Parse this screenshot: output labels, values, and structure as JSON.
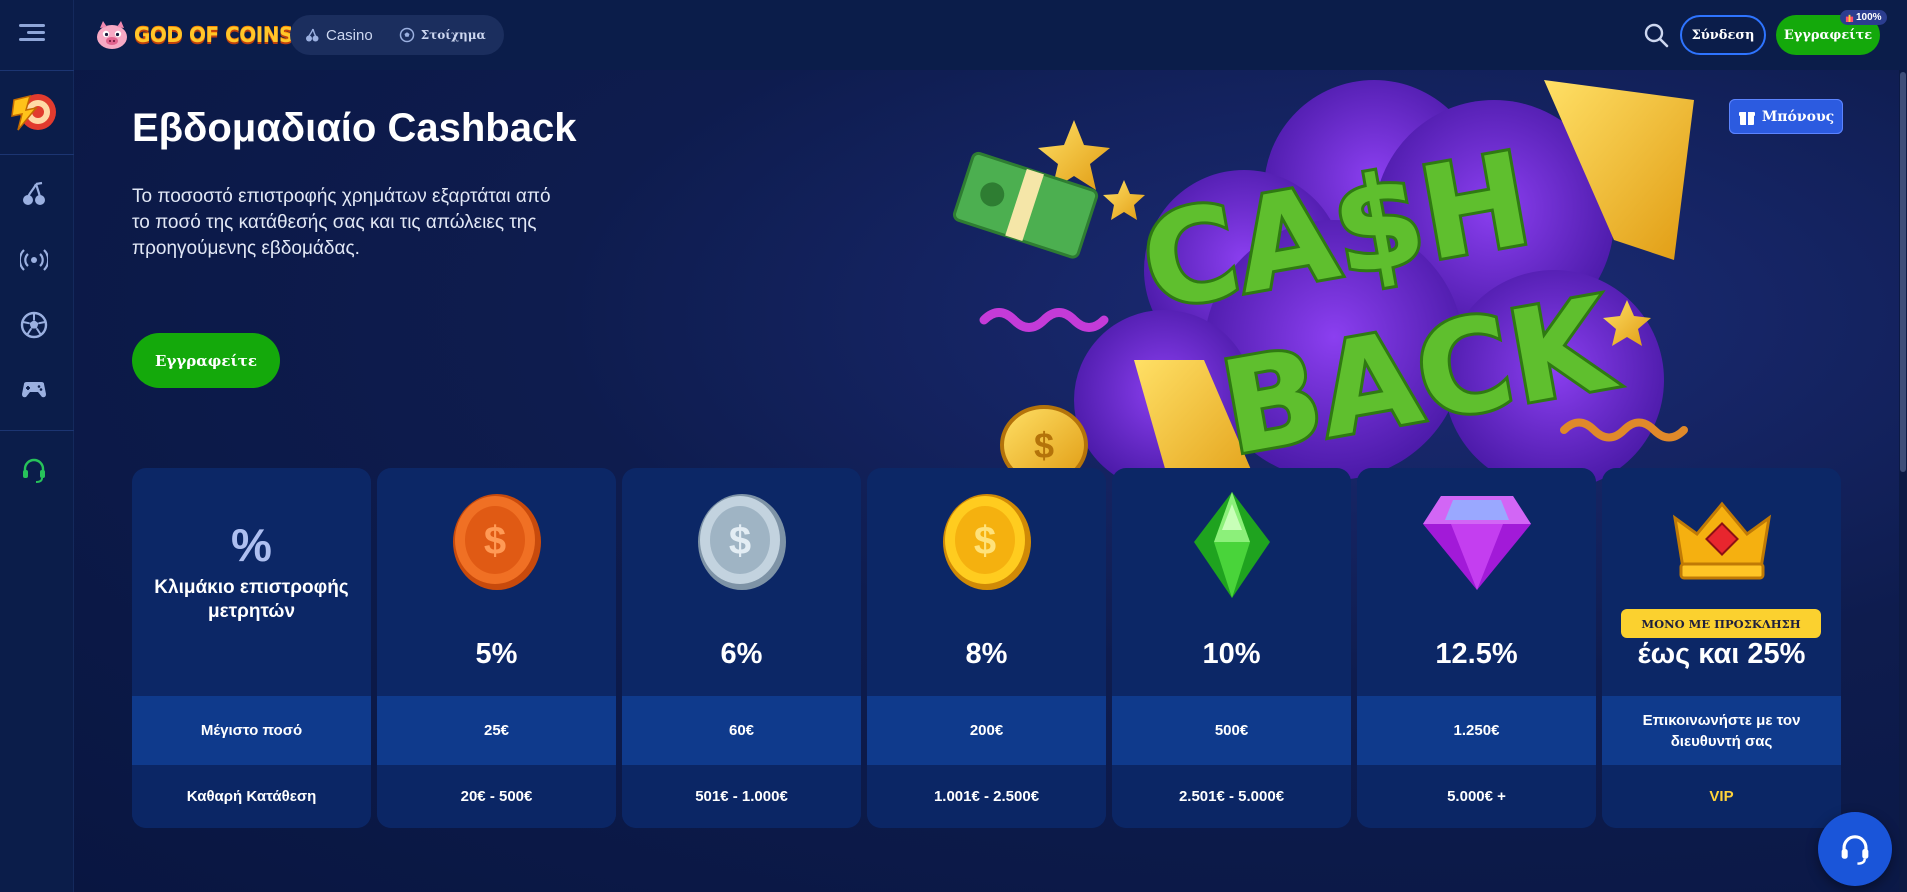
{
  "topbar": {
    "logo": "GOD OF COINS",
    "nav": [
      {
        "label": "Casino",
        "icon": "cherries-icon"
      },
      {
        "label": "Στοίχημα",
        "icon": "soccer-ball-icon"
      }
    ],
    "login_label": "Σύνδεση",
    "register_label": "Εγγραφείτε",
    "register_badge": "100%"
  },
  "sidebar": {
    "items": [
      {
        "name": "casino",
        "icon": "cherries-icon"
      },
      {
        "name": "live",
        "icon": "broadcast-icon"
      },
      {
        "name": "sports",
        "icon": "soccer-ball-icon"
      },
      {
        "name": "games",
        "icon": "gamepad-icon"
      },
      {
        "name": "support",
        "icon": "headset-icon"
      }
    ]
  },
  "hero": {
    "title": "Εβδομαδιαίο Cashback",
    "description": "Το ποσοστό επιστροφής χρημάτων εξαρτάται από το ποσό της κατάθεσής σας και τις απώλειες της προηγούμενης εβδομάδας.",
    "cta_label": "Εγγραφείτε",
    "bonus_label": "Μπόνους",
    "art_text": [
      "CA$H",
      "BACK"
    ]
  },
  "table": {
    "header": {
      "symbol": "%",
      "label": "Κλιμάκιο επιστροφής μετρητών",
      "max_label": "Μέγιστο ποσό",
      "deposit_label": "Καθαρή Κατάθεση"
    },
    "tiers": [
      {
        "icon": "bronze-coin-icon",
        "percent": "5%",
        "max": "25€",
        "deposit": "20€ - 500€"
      },
      {
        "icon": "silver-coin-icon",
        "percent": "6%",
        "max": "60€",
        "deposit": "501€ - 1.000€"
      },
      {
        "icon": "gold-coin-icon",
        "percent": "8%",
        "max": "200€",
        "deposit": "1.001€ - 2.500€"
      },
      {
        "icon": "emerald-gem-icon",
        "percent": "10%",
        "max": "500€",
        "deposit": "2.501€ - 5.000€"
      },
      {
        "icon": "amethyst-gem-icon",
        "percent": "12.5%",
        "max": "1.250€",
        "deposit": "5.000€ +"
      }
    ],
    "vip": {
      "icon": "crown-icon",
      "badge": "ΜΟΝΟ ΜΕ ΠΡΟΣΚΛΗΣΗ",
      "percent": "έως και 25%",
      "max": "Επικοινωνήστε με τον διευθυντή σας",
      "deposit": "VIP"
    }
  },
  "colors": {
    "background": "#0a1a3f",
    "card": "#0c2766",
    "card_row": "#0f3a8c",
    "primary_green": "#14a90b",
    "accent_blue": "#2e74ff",
    "vip_yellow": "#ffd23a"
  }
}
